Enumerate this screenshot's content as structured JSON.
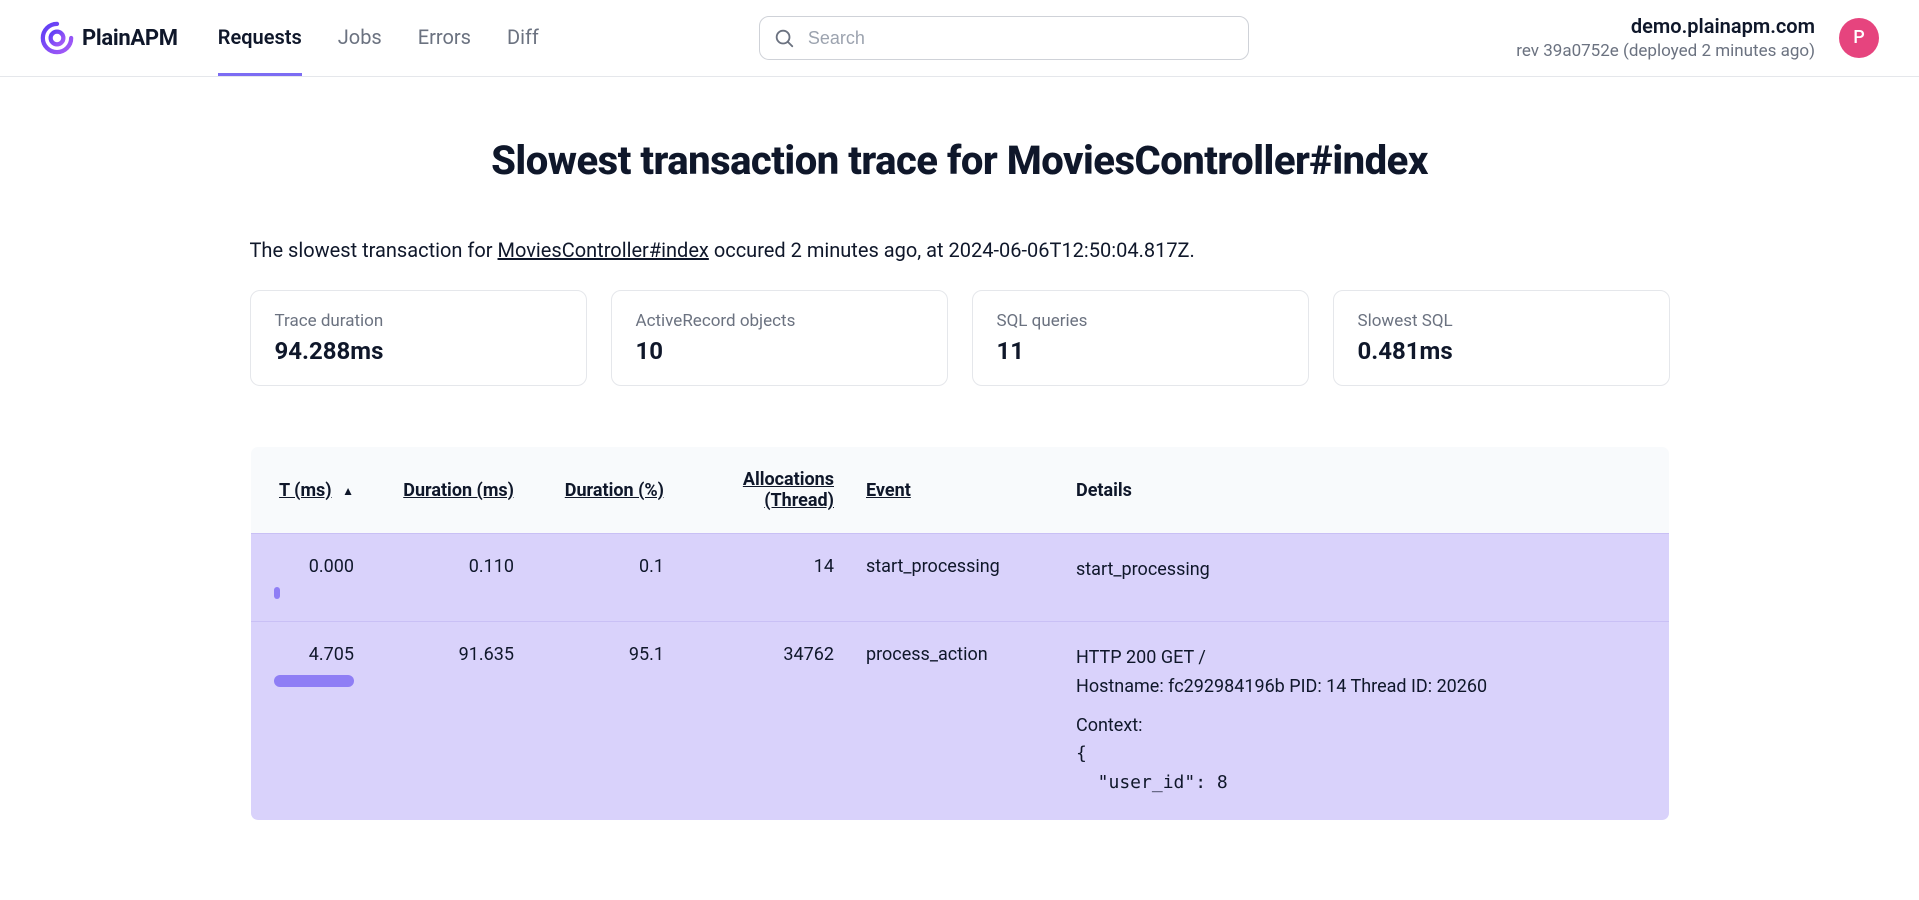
{
  "brand": {
    "name": "PlainAPM"
  },
  "nav": {
    "items": [
      {
        "label": "Requests",
        "active": true
      },
      {
        "label": "Jobs",
        "active": false
      },
      {
        "label": "Errors",
        "active": false
      },
      {
        "label": "Diff",
        "active": false
      }
    ]
  },
  "search": {
    "placeholder": "Search"
  },
  "header": {
    "domain": "demo.plainapm.com",
    "deploy_line": "rev 39a0752e (deployed 2 minutes ago)",
    "avatar_initial": "P"
  },
  "page": {
    "title": "Slowest transaction trace for MoviesController#index",
    "intro_prefix": "The slowest transaction for ",
    "intro_link": "MoviesController#index",
    "intro_suffix": " occured 2 minutes ago, at 2024-06-06T12:50:04.817Z."
  },
  "stats": [
    {
      "label": "Trace duration",
      "value": "94.288ms"
    },
    {
      "label": "ActiveRecord objects",
      "value": "10"
    },
    {
      "label": "SQL queries",
      "value": "11"
    },
    {
      "label": "Slowest SQL",
      "value": "0.481ms"
    }
  ],
  "table": {
    "headers": {
      "t": "T (ms)",
      "duration": "Duration (ms)",
      "pct": "Duration (%)",
      "alloc_line1": "Allocations",
      "alloc_line2": "(Thread)",
      "event": "Event",
      "details": "Details"
    },
    "rows": [
      {
        "t": "0.000",
        "duration": "0.110",
        "pct": "0.1",
        "alloc": "14",
        "event": "start_processing",
        "details_line1": "start_processing",
        "details_line2": "",
        "context_label": "",
        "context_json": ""
      },
      {
        "t": "4.705",
        "duration": "91.635",
        "pct": "95.1",
        "alloc": "34762",
        "event": "process_action",
        "details_line1": "HTTP 200 GET /",
        "details_line2": "Hostname: fc292984196b PID: 14 Thread ID: 20260",
        "context_label": "Context:",
        "context_json": "{\n  \"user_id\": 8"
      }
    ]
  }
}
